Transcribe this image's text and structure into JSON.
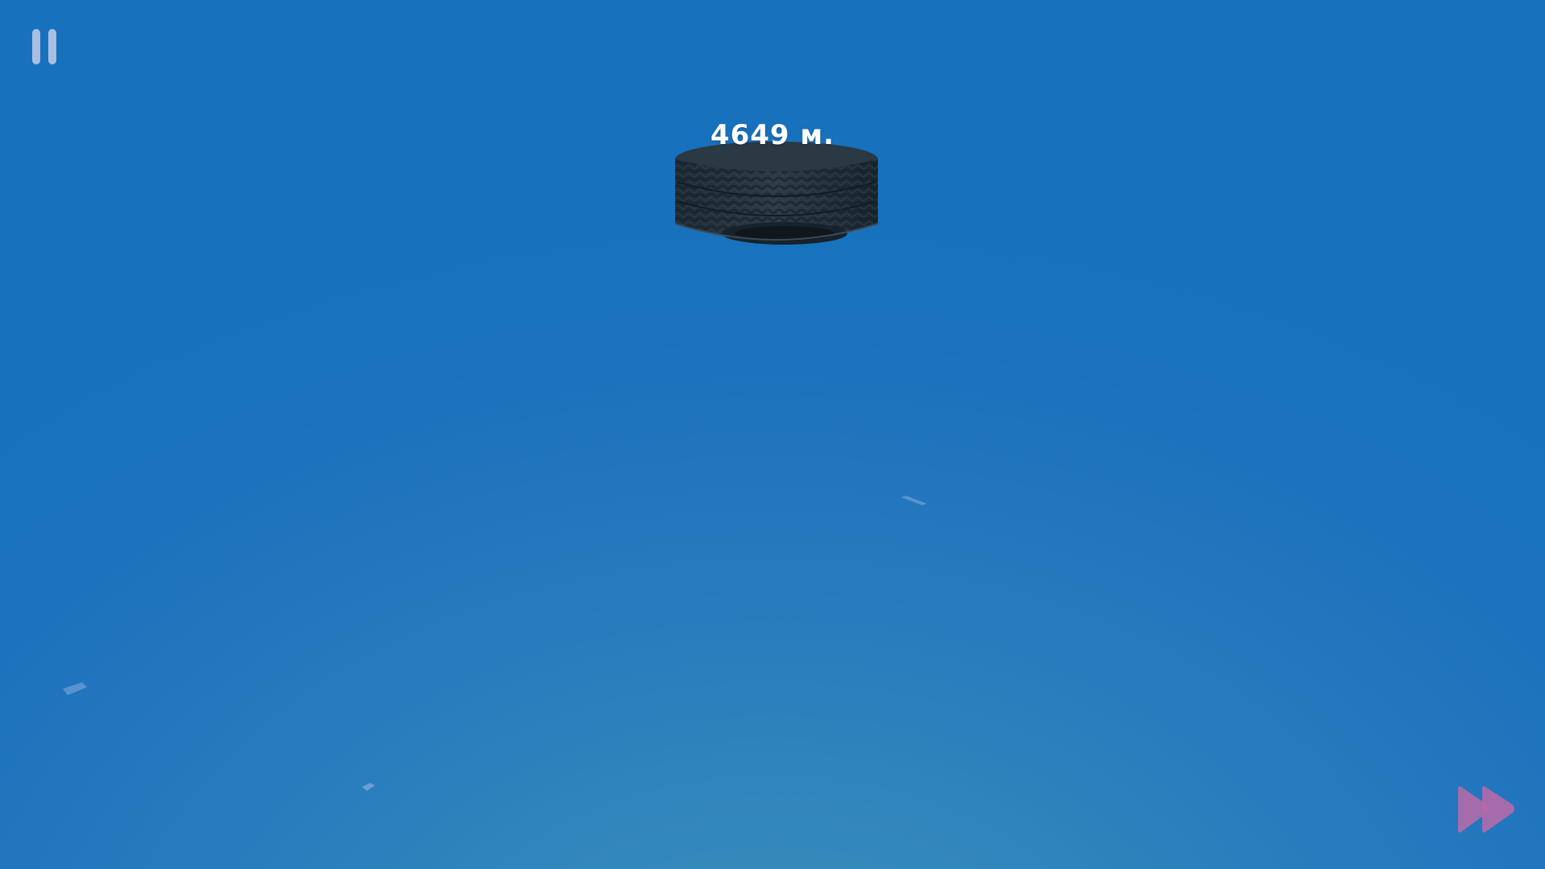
{
  "hud": {
    "distance_label": "4649 м.",
    "pause_icon": "pause-icon",
    "fast_forward_icon": "fast-forward-icon"
  },
  "scene": {
    "object": "tire",
    "sky_color_top": "#1771bd",
    "sky_color_bottom": "#3f90b8",
    "debris_count": 3
  },
  "colors": {
    "pause": "#b9c8e6",
    "fast_forward": "#b46aa8",
    "text": "#ffffff"
  }
}
